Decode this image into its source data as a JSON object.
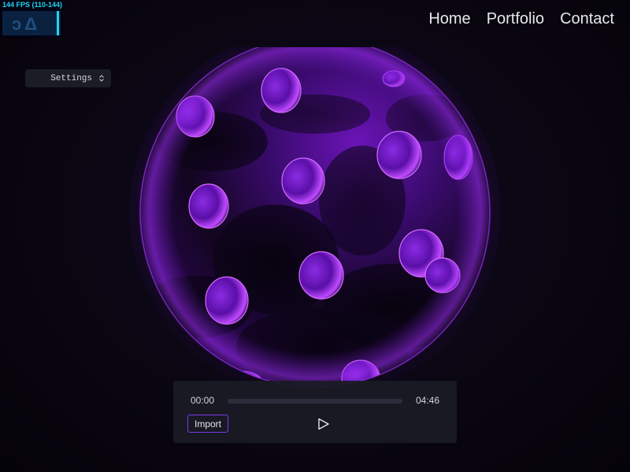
{
  "fps_meter": {
    "label": "144 FPS (110-144)",
    "ghost": "ɔΔ"
  },
  "nav": {
    "items": [
      {
        "label": "Home"
      },
      {
        "label": "Portfolio"
      },
      {
        "label": "Contact"
      }
    ]
  },
  "settings": {
    "label": "Settings",
    "icon": "updown-arrows-icon"
  },
  "player": {
    "current_time": "00:00",
    "duration": "04:46",
    "progress": 0,
    "import_label": "Import",
    "play_icon": "play-icon"
  },
  "colors": {
    "accent": "#8b5cf6",
    "fps": "#22d3ee",
    "sphere_glow": "#a020f0"
  }
}
